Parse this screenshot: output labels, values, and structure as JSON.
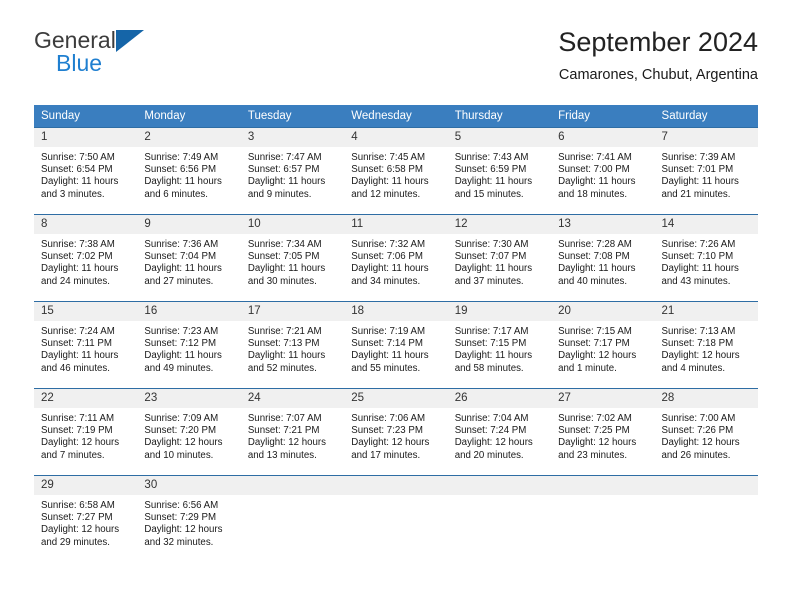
{
  "brand": {
    "name_top": "General",
    "name_bottom": "Blue",
    "accent_color": "#1f7fd0",
    "triangle_color": "#1565a8"
  },
  "header": {
    "title": "September 2024",
    "subtitle": "Camarones, Chubut, Argentina"
  },
  "calendar": {
    "header_bg": "#3a7ebf",
    "row_border_color": "#2e6da4",
    "daynum_bg": "#f0f0f0",
    "weekdays": [
      "Sunday",
      "Monday",
      "Tuesday",
      "Wednesday",
      "Thursday",
      "Friday",
      "Saturday"
    ],
    "weeks": [
      [
        {
          "day": "1",
          "sunrise": "Sunrise: 7:50 AM",
          "sunset": "Sunset: 6:54 PM",
          "daylight": "Daylight: 11 hours and 3 minutes."
        },
        {
          "day": "2",
          "sunrise": "Sunrise: 7:49 AM",
          "sunset": "Sunset: 6:56 PM",
          "daylight": "Daylight: 11 hours and 6 minutes."
        },
        {
          "day": "3",
          "sunrise": "Sunrise: 7:47 AM",
          "sunset": "Sunset: 6:57 PM",
          "daylight": "Daylight: 11 hours and 9 minutes."
        },
        {
          "day": "4",
          "sunrise": "Sunrise: 7:45 AM",
          "sunset": "Sunset: 6:58 PM",
          "daylight": "Daylight: 11 hours and 12 minutes."
        },
        {
          "day": "5",
          "sunrise": "Sunrise: 7:43 AM",
          "sunset": "Sunset: 6:59 PM",
          "daylight": "Daylight: 11 hours and 15 minutes."
        },
        {
          "day": "6",
          "sunrise": "Sunrise: 7:41 AM",
          "sunset": "Sunset: 7:00 PM",
          "daylight": "Daylight: 11 hours and 18 minutes."
        },
        {
          "day": "7",
          "sunrise": "Sunrise: 7:39 AM",
          "sunset": "Sunset: 7:01 PM",
          "daylight": "Daylight: 11 hours and 21 minutes."
        }
      ],
      [
        {
          "day": "8",
          "sunrise": "Sunrise: 7:38 AM",
          "sunset": "Sunset: 7:02 PM",
          "daylight": "Daylight: 11 hours and 24 minutes."
        },
        {
          "day": "9",
          "sunrise": "Sunrise: 7:36 AM",
          "sunset": "Sunset: 7:04 PM",
          "daylight": "Daylight: 11 hours and 27 minutes."
        },
        {
          "day": "10",
          "sunrise": "Sunrise: 7:34 AM",
          "sunset": "Sunset: 7:05 PM",
          "daylight": "Daylight: 11 hours and 30 minutes."
        },
        {
          "day": "11",
          "sunrise": "Sunrise: 7:32 AM",
          "sunset": "Sunset: 7:06 PM",
          "daylight": "Daylight: 11 hours and 34 minutes."
        },
        {
          "day": "12",
          "sunrise": "Sunrise: 7:30 AM",
          "sunset": "Sunset: 7:07 PM",
          "daylight": "Daylight: 11 hours and 37 minutes."
        },
        {
          "day": "13",
          "sunrise": "Sunrise: 7:28 AM",
          "sunset": "Sunset: 7:08 PM",
          "daylight": "Daylight: 11 hours and 40 minutes."
        },
        {
          "day": "14",
          "sunrise": "Sunrise: 7:26 AM",
          "sunset": "Sunset: 7:10 PM",
          "daylight": "Daylight: 11 hours and 43 minutes."
        }
      ],
      [
        {
          "day": "15",
          "sunrise": "Sunrise: 7:24 AM",
          "sunset": "Sunset: 7:11 PM",
          "daylight": "Daylight: 11 hours and 46 minutes."
        },
        {
          "day": "16",
          "sunrise": "Sunrise: 7:23 AM",
          "sunset": "Sunset: 7:12 PM",
          "daylight": "Daylight: 11 hours and 49 minutes."
        },
        {
          "day": "17",
          "sunrise": "Sunrise: 7:21 AM",
          "sunset": "Sunset: 7:13 PM",
          "daylight": "Daylight: 11 hours and 52 minutes."
        },
        {
          "day": "18",
          "sunrise": "Sunrise: 7:19 AM",
          "sunset": "Sunset: 7:14 PM",
          "daylight": "Daylight: 11 hours and 55 minutes."
        },
        {
          "day": "19",
          "sunrise": "Sunrise: 7:17 AM",
          "sunset": "Sunset: 7:15 PM",
          "daylight": "Daylight: 11 hours and 58 minutes."
        },
        {
          "day": "20",
          "sunrise": "Sunrise: 7:15 AM",
          "sunset": "Sunset: 7:17 PM",
          "daylight": "Daylight: 12 hours and 1 minute."
        },
        {
          "day": "21",
          "sunrise": "Sunrise: 7:13 AM",
          "sunset": "Sunset: 7:18 PM",
          "daylight": "Daylight: 12 hours and 4 minutes."
        }
      ],
      [
        {
          "day": "22",
          "sunrise": "Sunrise: 7:11 AM",
          "sunset": "Sunset: 7:19 PM",
          "daylight": "Daylight: 12 hours and 7 minutes."
        },
        {
          "day": "23",
          "sunrise": "Sunrise: 7:09 AM",
          "sunset": "Sunset: 7:20 PM",
          "daylight": "Daylight: 12 hours and 10 minutes."
        },
        {
          "day": "24",
          "sunrise": "Sunrise: 7:07 AM",
          "sunset": "Sunset: 7:21 PM",
          "daylight": "Daylight: 12 hours and 13 minutes."
        },
        {
          "day": "25",
          "sunrise": "Sunrise: 7:06 AM",
          "sunset": "Sunset: 7:23 PM",
          "daylight": "Daylight: 12 hours and 17 minutes."
        },
        {
          "day": "26",
          "sunrise": "Sunrise: 7:04 AM",
          "sunset": "Sunset: 7:24 PM",
          "daylight": "Daylight: 12 hours and 20 minutes."
        },
        {
          "day": "27",
          "sunrise": "Sunrise: 7:02 AM",
          "sunset": "Sunset: 7:25 PM",
          "daylight": "Daylight: 12 hours and 23 minutes."
        },
        {
          "day": "28",
          "sunrise": "Sunrise: 7:00 AM",
          "sunset": "Sunset: 7:26 PM",
          "daylight": "Daylight: 12 hours and 26 minutes."
        }
      ],
      [
        {
          "day": "29",
          "sunrise": "Sunrise: 6:58 AM",
          "sunset": "Sunset: 7:27 PM",
          "daylight": "Daylight: 12 hours and 29 minutes."
        },
        {
          "day": "30",
          "sunrise": "Sunrise: 6:56 AM",
          "sunset": "Sunset: 7:29 PM",
          "daylight": "Daylight: 12 hours and 32 minutes."
        },
        {
          "day": "",
          "sunrise": "",
          "sunset": "",
          "daylight": ""
        },
        {
          "day": "",
          "sunrise": "",
          "sunset": "",
          "daylight": ""
        },
        {
          "day": "",
          "sunrise": "",
          "sunset": "",
          "daylight": ""
        },
        {
          "day": "",
          "sunrise": "",
          "sunset": "",
          "daylight": ""
        },
        {
          "day": "",
          "sunrise": "",
          "sunset": "",
          "daylight": ""
        }
      ]
    ]
  }
}
